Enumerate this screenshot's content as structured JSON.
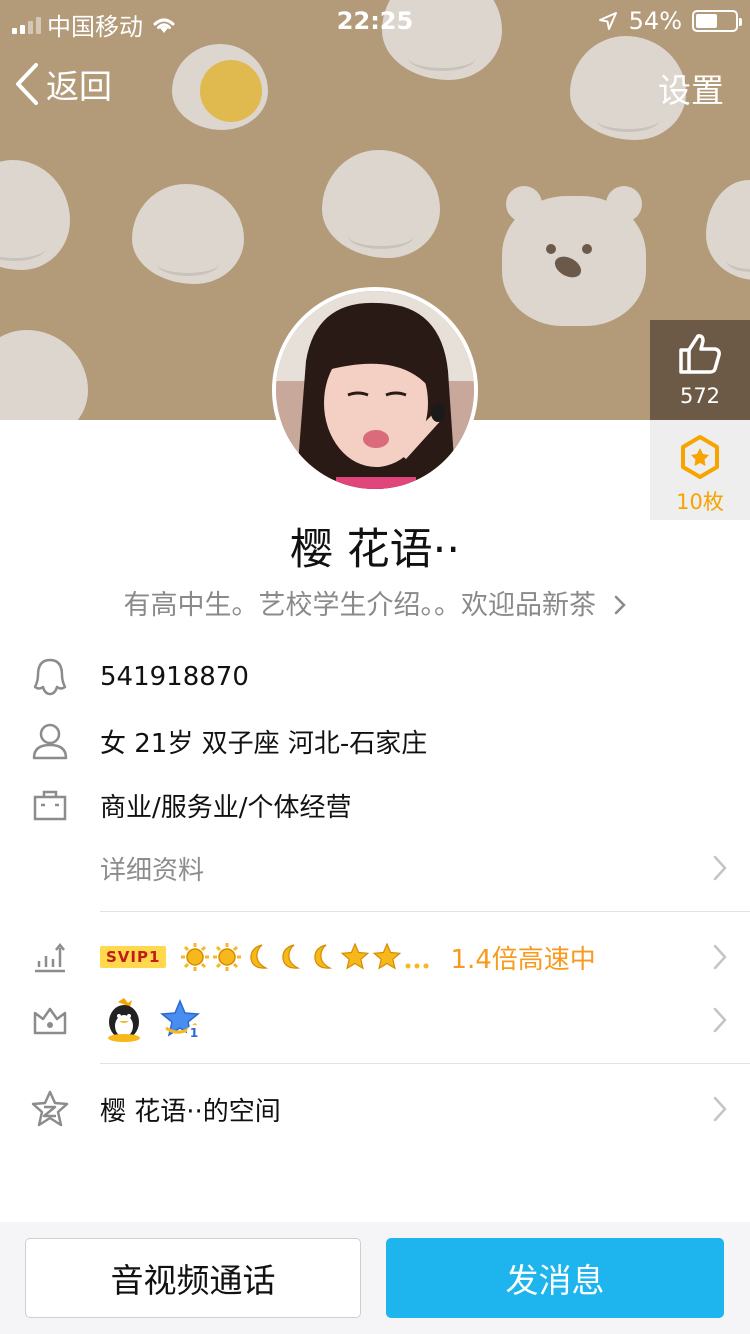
{
  "status_bar": {
    "carrier": "中国移动",
    "time": "22:25",
    "battery": "54%"
  },
  "nav": {
    "back_label": "返回",
    "settings_label": "设置"
  },
  "side": {
    "likes": "572",
    "badges": "10枚"
  },
  "profile": {
    "name": "樱 花语··",
    "signature": "有高中生。艺校学生介绍。。欢迎品新茶",
    "qq_number": "541918870",
    "personal": "女 21岁 双子座 河北-石家庄",
    "occupation": "商业/服务业/个体经营",
    "details_label": "详细资料"
  },
  "vip": {
    "tag": "SVIP1",
    "speed": "1.4倍高速中"
  },
  "space": {
    "label": "樱 花语··的空间"
  },
  "buttons": {
    "call": "音视频通话",
    "message": "发消息"
  },
  "colors": {
    "accent_blue": "#1eb5ef",
    "speed_orange": "#f79a1e",
    "cover_bg": "#b39a79"
  },
  "icons": [
    "back-chevron-icon",
    "thumbs-up-icon",
    "star-badge-icon",
    "qq-penguin-icon",
    "person-icon",
    "briefcase-icon",
    "level-chart-icon",
    "crown-icon",
    "space-star-icon",
    "chevron-right-icon"
  ]
}
